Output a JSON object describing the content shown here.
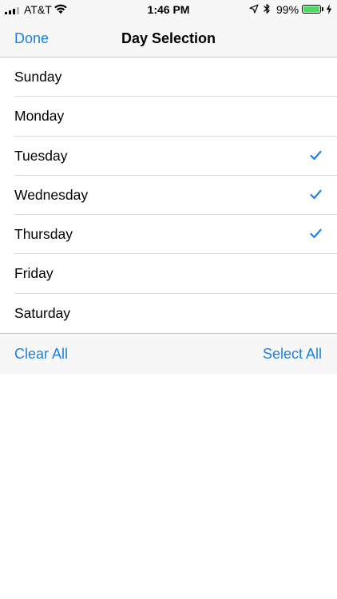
{
  "status_bar": {
    "carrier": "AT&T",
    "time": "1:46 PM",
    "battery_percent_label": "99%",
    "battery_level": 0.99,
    "signal_bars_filled": 3,
    "signal_bars_total": 4,
    "icons": {
      "signal": "cellular-signal-icon",
      "wifi": "wifi-icon",
      "location": "location-arrow-icon",
      "bluetooth": "bluetooth-icon",
      "battery": "battery-icon",
      "charging": "charging-bolt-icon"
    },
    "colors": {
      "battery_fill": "#4cd964"
    }
  },
  "nav": {
    "done_label": "Done",
    "title": "Day Selection"
  },
  "days": [
    {
      "label": "Sunday",
      "checked": false
    },
    {
      "label": "Monday",
      "checked": false
    },
    {
      "label": "Tuesday",
      "checked": true
    },
    {
      "label": "Wednesday",
      "checked": true
    },
    {
      "label": "Thursday",
      "checked": true
    },
    {
      "label": "Friday",
      "checked": false
    },
    {
      "label": "Saturday",
      "checked": false
    }
  ],
  "toolbar": {
    "clear_all_label": "Clear All",
    "select_all_label": "Select All"
  },
  "colors": {
    "accent": "#1f7fe0",
    "bar_background": "#f7f7f7",
    "separator": "#c8c7cc"
  }
}
